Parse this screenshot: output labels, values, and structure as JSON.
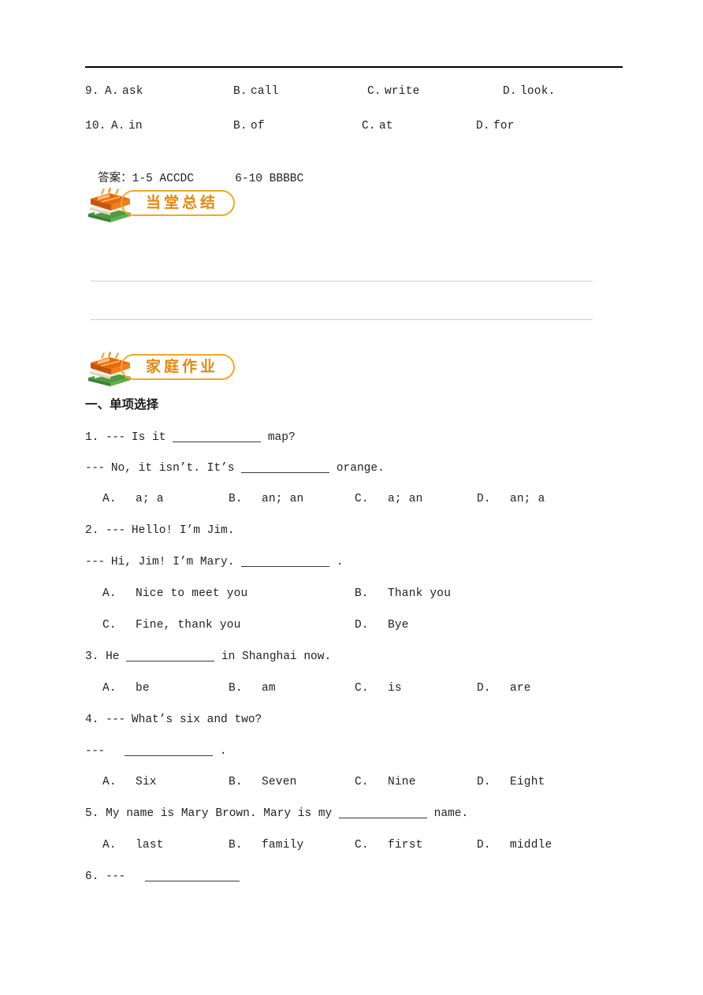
{
  "document": {
    "top_rule": true
  },
  "cloze_tail": {
    "items": [
      {
        "number": "9.",
        "options": [
          {
            "letter": "A.",
            "text": "ask"
          },
          {
            "letter": "B.",
            "text": "call"
          },
          {
            "letter": "C.",
            "text": "write"
          },
          {
            "letter": "D.",
            "text": "look."
          }
        ]
      },
      {
        "number": "10.",
        "options": [
          {
            "letter": "A.",
            "text": "in"
          },
          {
            "letter": "B.",
            "text": "of"
          },
          {
            "letter": "C.",
            "text": "at"
          },
          {
            "letter": "D.",
            "text": "for"
          }
        ]
      }
    ],
    "answer_key_label": "答案：",
    "answer_key_range_1": "1-5 ACCDC",
    "answer_key_range_2": "6-10 BBBBC"
  },
  "summary_section": {
    "banner_label": "当堂总结",
    "banner_icon": "stacked-books-icon",
    "blank_lines": 2
  },
  "homework_section": {
    "banner_label": "家庭作业",
    "banner_icon": "stacked-books-icon",
    "heading": "一、单项选择",
    "questions": [
      {
        "number": "1.",
        "lines": [
          {
            "dash": "---",
            "pre": "Is it",
            "blank": 112,
            "post": "map?"
          },
          {
            "dash": "---",
            "pre": "No, it isn’t. It’s",
            "blank": 112,
            "post": "orange."
          }
        ],
        "layout": "four-column",
        "options": [
          {
            "letter": "A.",
            "text": "a; a"
          },
          {
            "letter": "B.",
            "text": "an; an"
          },
          {
            "letter": "C.",
            "text": "a; an"
          },
          {
            "letter": "D.",
            "text": "an; a"
          }
        ]
      },
      {
        "number": "2.",
        "lines": [
          {
            "dash": "---",
            "pre": "Hello! I’m Jim.",
            "blank": 0,
            "post": ""
          },
          {
            "dash": "---",
            "pre": "Hi, Jim! I’m Mary.",
            "blank": 112,
            "post": "."
          }
        ],
        "layout": "two-column",
        "options": [
          {
            "letter": "A.",
            "text": "Nice to meet you"
          },
          {
            "letter": "B.",
            "text": "Thank you"
          },
          {
            "letter": "C.",
            "text": "Fine, thank you"
          },
          {
            "letter": "D.",
            "text": "Bye"
          }
        ]
      },
      {
        "number": "3.",
        "lines": [
          {
            "dash": "",
            "pre": "He",
            "blank": 112,
            "post": "in Shanghai now."
          }
        ],
        "layout": "four-column",
        "options": [
          {
            "letter": "A.",
            "text": "be"
          },
          {
            "letter": "B.",
            "text": "am"
          },
          {
            "letter": "C.",
            "text": "is"
          },
          {
            "letter": "D.",
            "text": "are"
          }
        ]
      },
      {
        "number": "4.",
        "lines": [
          {
            "dash": "---",
            "pre": "What’s six and two?",
            "blank": 0,
            "post": ""
          },
          {
            "dash": "---",
            "pre": "",
            "blank": 112,
            "post": "."
          }
        ],
        "layout": "four-column",
        "options": [
          {
            "letter": "A.",
            "text": "Six"
          },
          {
            "letter": "B.",
            "text": "Seven"
          },
          {
            "letter": "C.",
            "text": "Nine"
          },
          {
            "letter": "D.",
            "text": "Eight"
          }
        ]
      },
      {
        "number": "5.",
        "lines": [
          {
            "dash": "",
            "pre": "My name is Mary Brown. Mary is my",
            "blank": 112,
            "post": "name."
          }
        ],
        "layout": "four-column",
        "options": [
          {
            "letter": "A.",
            "text": "last"
          },
          {
            "letter": "B.",
            "text": "family"
          },
          {
            "letter": "C.",
            "text": "first"
          },
          {
            "letter": "D.",
            "text": "middle"
          }
        ]
      },
      {
        "number": "6.",
        "lines": [
          {
            "dash": "---",
            "pre": "",
            "blank": 120,
            "post": ""
          }
        ],
        "layout": "none",
        "options": []
      }
    ]
  },
  "colors": {
    "banner_border": "#F5A623",
    "banner_text": "#E8860C",
    "book_orange": "#E8690B",
    "book_green": "#4E9A3E",
    "rule_black": "#000000",
    "write_line_gray": "#cdcdcd"
  }
}
